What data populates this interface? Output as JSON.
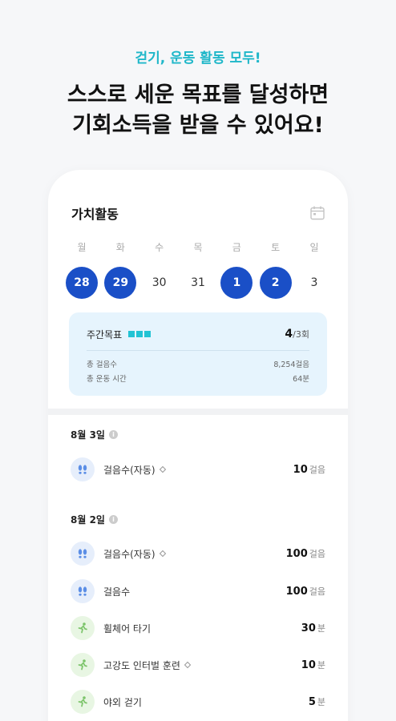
{
  "promo": {
    "tag": "걷기, 운동 활동 모두!",
    "title_line1": "스스로 세운 목표를 달성하면",
    "title_line2": "기회소득을 받을 수 있어요!"
  },
  "screen": {
    "title": "가치활동",
    "weekdays": [
      "월",
      "화",
      "수",
      "목",
      "금",
      "토",
      "일"
    ],
    "dates": [
      {
        "label": "28",
        "active": true
      },
      {
        "label": "29",
        "active": true
      },
      {
        "label": "30",
        "active": false
      },
      {
        "label": "31",
        "active": false
      },
      {
        "label": "1",
        "active": true
      },
      {
        "label": "2",
        "active": true
      },
      {
        "label": "3",
        "active": false
      }
    ],
    "goal": {
      "label": "주간목표",
      "achieved": "4",
      "target": "/3회",
      "stats": [
        {
          "label": "총 걸음수",
          "value": "8,254걸음"
        },
        {
          "label": "총 운동 시간",
          "value": "64분"
        }
      ]
    },
    "days": [
      {
        "date": "8월 3일",
        "activities": [
          {
            "icon": "footprints-icon",
            "type": "step",
            "name": "걸음수(자동)",
            "synced": true,
            "value": "10",
            "unit": "걸음"
          }
        ]
      },
      {
        "date": "8월 2일",
        "activities": [
          {
            "icon": "footprints-icon",
            "type": "step",
            "name": "걸음수(자동)",
            "synced": true,
            "value": "100",
            "unit": "걸음"
          },
          {
            "icon": "footprints-icon",
            "type": "step",
            "name": "걸음수",
            "synced": false,
            "value": "100",
            "unit": "걸음"
          },
          {
            "icon": "runner-icon",
            "type": "exercise",
            "name": "휠체어 타기",
            "synced": false,
            "value": "30",
            "unit": "분"
          },
          {
            "icon": "runner-icon",
            "type": "exercise",
            "name": "고강도 인터벌 훈련",
            "synced": true,
            "value": "10",
            "unit": "분"
          },
          {
            "icon": "runner-icon",
            "type": "exercise",
            "name": "야외 걷기",
            "synced": false,
            "value": "5",
            "unit": "분"
          }
        ]
      }
    ]
  },
  "colors": {
    "accent_teal": "#1fb7c9",
    "active_date": "#1a4fc7",
    "goal_card": "#e6f4fd"
  }
}
